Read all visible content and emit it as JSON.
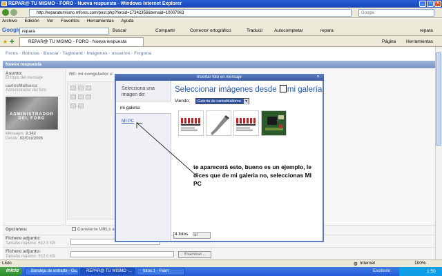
{
  "window": {
    "title": "REPAR@ TU MISMO - FORO - Nueva respuesta - Windows Internet Explorer"
  },
  "address": {
    "url": "http://reparatumismo.mforos.com/post.php?foroid=17342356&temaid=10007963",
    "search_placeholder": "Google"
  },
  "menu": [
    "Archivo",
    "Edición",
    "Ver",
    "Favoritos",
    "Herramientas",
    "Ayuda"
  ],
  "google_bar": {
    "query": "repara",
    "buscar": "Buscar",
    "compartir": "Compartir",
    "corrector": "Corrector ortográfico",
    "traducir": "Traducir",
    "autocompletar": "Autocompletar",
    "repara_link": "repara",
    "right_link": "repara"
  },
  "tab": {
    "title": "REPAR@ TU MISMO - FORO - Nueva respuesta",
    "pagina": "Página",
    "herramientas": "Herramientas"
  },
  "forum": {
    "breadcrumb": "Foros · Noticias · Buscar · Tagboard · Imágenes · usuarios · Fisgona",
    "section": "Nueva respuesta",
    "asunto_label": "Asunto:",
    "asunto_sub": "El título del mensaje",
    "asunto_value": "RE: mi congelador e",
    "user_name": "carlosMallorca",
    "user_role": "Administrador del foro",
    "avatar_text": "ADMINISTRADOR DEL FORO",
    "mensajes_label": "Mensajes:",
    "mensajes_value": "3.342",
    "desde_label": "Desde:",
    "desde_value": "02/Oct/2006",
    "opciones_label": "Opciones:",
    "convierte": "Convierte URLs e",
    "fichero1_label": "Fichero adjunto:",
    "fichero1_sub": "Tamaño máximo: 512.0 KB",
    "fichero2_label": "Fichero adjunto:",
    "fichero2_sub": "Tamaño máximo: 512.0 KB",
    "examinar": "Examinar..."
  },
  "dialog": {
    "title": "Insertar foto en mensaje",
    "select_header": "Selecciona una imagen de:",
    "mi_galeria": "mi galeria",
    "mi_pc": "MI PC",
    "heading_left": "Seleccionar imágenes desde",
    "heading_right": "mi galería",
    "viendo_label": "Viendo:",
    "viendo_value": "Galería de carlosMallorca",
    "photo_count": "4 fotos",
    "cerrar": "Cerrar",
    "annotation": "te aparecerá esto, bueno es un ejemplo, le dices que de mi galeria no, seleccionas MI PC"
  },
  "status": {
    "left": "Listo",
    "zone": "Internet",
    "zoom": "100%"
  },
  "taskbar": {
    "start": "Inicio",
    "tasks": [
      "Bandeja de entrada - Ou...",
      "REPAR@ TU MISMO -...",
      "fotos 1 - Paint"
    ],
    "lang": "Escritorio",
    "clock": "1:50"
  }
}
